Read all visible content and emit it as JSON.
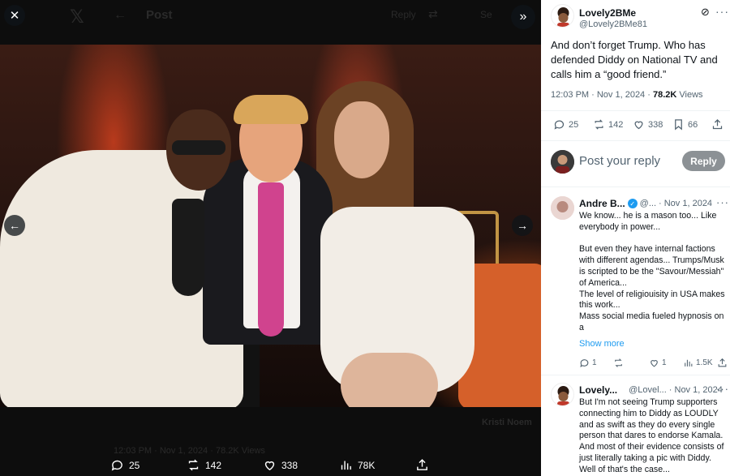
{
  "viewer": {
    "background_header": {
      "title": "Post",
      "reply_label": "Reply",
      "search_placeholder": "Se"
    },
    "background_footer": {
      "timestamp": "12:03 PM · Nov 1, 2024 · 78.2K Views",
      "side_name": "Kristi Noem"
    },
    "actions": {
      "replies": "25",
      "reposts": "142",
      "likes": "338",
      "views": "78K"
    }
  },
  "post": {
    "author_name": "Lovely2BMe",
    "author_handle": "@Lovely2BMe81",
    "text": "And don’t forget Trump. Who has defended Diddy on National TV and calls him a “good friend.”",
    "time": "12:03 PM · Nov 1, 2024 · ",
    "views_count": "78.2K",
    "views_label": " Views",
    "replies": "25",
    "reposts": "142",
    "likes": "338",
    "bookmarks": "66"
  },
  "reply_box": {
    "placeholder": "Post your reply",
    "button_label": "Reply"
  },
  "replies": [
    {
      "name": "Andre B...",
      "handle": "@...",
      "date": "· Nov 1, 2024",
      "text_lines": [
        "We know... he is a mason too... Like everybody in power...",
        "",
        "But even they have internal factions with different agendas... Trumps/Musk is scripted to be the \"Savour/Messiah\" of America...",
        "The level of religiouisity in USA makes this work...",
        "Mass social media fueled hypnosis on a"
      ],
      "show_more": "Show more",
      "replies": "1",
      "likes": "1",
      "views": "1.5K"
    },
    {
      "name": "Lovely...",
      "handle": "@Lovel...",
      "date": "· Nov 1, 2024",
      "text": "But I'm not seeing Trump supporters connecting him to Diddy as LOUDLY and as swift as they do every single person that dares to endorse Kamala.  And most of their evidence consists of just literally taking a pic with Diddy.  Well of that's the case..."
    }
  ],
  "colors": {
    "accent": "#1d9bf0",
    "text": "#0f1419",
    "muted": "#536471",
    "reply_button": "#8c9195"
  }
}
